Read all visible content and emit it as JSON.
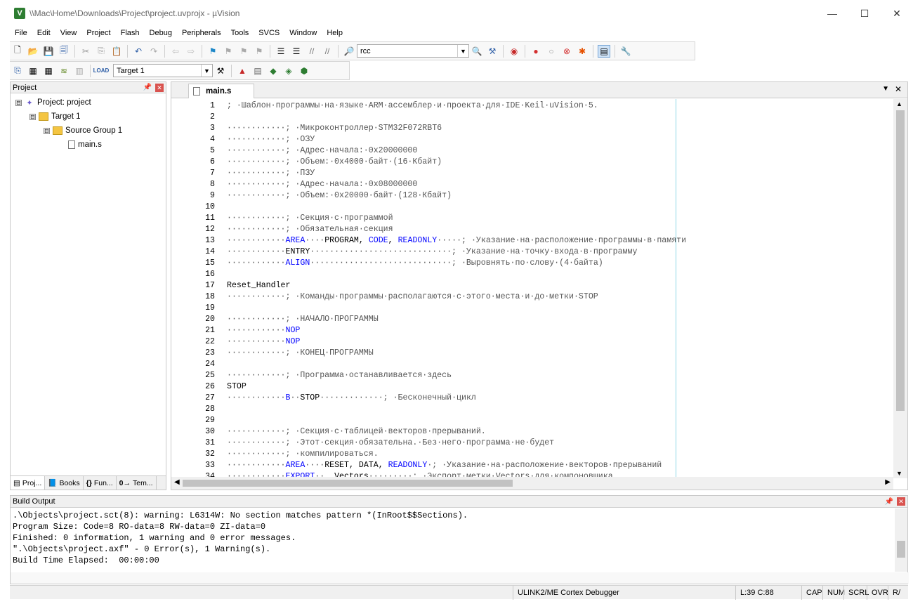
{
  "window": {
    "title": "\\\\Mac\\Home\\Downloads\\Project\\project.uvprojx - µVision",
    "logo": "V",
    "controls": {
      "minimize": "—",
      "maximize": "☐",
      "close": "✕"
    }
  },
  "menu": [
    "File",
    "Edit",
    "View",
    "Project",
    "Flash",
    "Debug",
    "Peripherals",
    "Tools",
    "SVCS",
    "Window",
    "Help"
  ],
  "toolbar": {
    "find_value": "rcc",
    "target_value": "Target 1"
  },
  "project_panel": {
    "title": "Project",
    "tree": [
      {
        "label": "Project: project",
        "expander": "⊟"
      },
      {
        "label": "Target 1",
        "expander": "⊟"
      },
      {
        "label": "Source Group 1",
        "expander": "⊟"
      },
      {
        "label": "main.s"
      }
    ],
    "tabs": [
      "Proj...",
      "Books",
      "Fun...",
      "Tem..."
    ]
  },
  "editor": {
    "tab_label": "main.s",
    "lines": [
      {
        "n": "1",
        "segs": [
          {
            "t": "; ·Шаблон·программы·на·языке·ARM·ассемблер·и·проекта·для·IDE·Keil·uVision·5.",
            "c": "g"
          }
        ]
      },
      {
        "n": "2",
        "segs": []
      },
      {
        "n": "3",
        "segs": [
          {
            "t": "············; ·Микроконтроллер·STM32F072RBT6",
            "c": "g"
          }
        ]
      },
      {
        "n": "4",
        "segs": [
          {
            "t": "············; ·ОЗУ",
            "c": "g"
          }
        ]
      },
      {
        "n": "5",
        "segs": [
          {
            "t": "············; ·Адрес·начала:·0x20000000",
            "c": "g"
          }
        ]
      },
      {
        "n": "6",
        "segs": [
          {
            "t": "············; ·Объем:·0x4000·байт·(16·Кбайт)",
            "c": "g"
          }
        ]
      },
      {
        "n": "7",
        "segs": [
          {
            "t": "············; ·ПЗУ",
            "c": "g"
          }
        ]
      },
      {
        "n": "8",
        "segs": [
          {
            "t": "············; ·Адрес·начала:·0x08000000",
            "c": "g"
          }
        ]
      },
      {
        "n": "9",
        "segs": [
          {
            "t": "············; ·Объем:·0x20000·байт·(128·Кбайт)",
            "c": "g"
          }
        ]
      },
      {
        "n": "10",
        "segs": []
      },
      {
        "n": "11",
        "segs": [
          {
            "t": "············; ·Секция·с·программой",
            "c": "g"
          }
        ]
      },
      {
        "n": "12",
        "segs": [
          {
            "t": "············; ·Обязательная·секция",
            "c": "g"
          }
        ]
      },
      {
        "n": "13",
        "segs": [
          {
            "t": "············",
            "c": "g"
          },
          {
            "t": "AREA",
            "c": "k"
          },
          {
            "t": "····",
            "c": "g"
          },
          {
            "t": "PROGRAM, ",
            "c": "d"
          },
          {
            "t": "CODE",
            "c": "k"
          },
          {
            "t": ", ",
            "c": "d"
          },
          {
            "t": "READONLY",
            "c": "k"
          },
          {
            "t": "·····; ·Указание·на·расположение·программы·в·памяти",
            "c": "g"
          }
        ]
      },
      {
        "n": "14",
        "segs": [
          {
            "t": "············",
            "c": "g"
          },
          {
            "t": "ENTRY",
            "c": "d"
          },
          {
            "t": "·····························; ·Указание·на·точку·входа·в·программу",
            "c": "g"
          }
        ]
      },
      {
        "n": "15",
        "segs": [
          {
            "t": "············",
            "c": "g"
          },
          {
            "t": "ALIGN",
            "c": "k"
          },
          {
            "t": "·····························; ·Выровнять·по·слову·(4·байта)",
            "c": "g"
          }
        ]
      },
      {
        "n": "16",
        "segs": []
      },
      {
        "n": "17",
        "segs": [
          {
            "t": "Reset_Handler",
            "c": "d"
          }
        ]
      },
      {
        "n": "18",
        "segs": [
          {
            "t": "············; ·Команды·программы·располагаются·с·этого·места·и·до·метки·STOP",
            "c": "g"
          }
        ]
      },
      {
        "n": "19",
        "segs": []
      },
      {
        "n": "20",
        "segs": [
          {
            "t": "············; ·НАЧАЛО·ПРОГРАММЫ",
            "c": "g"
          }
        ]
      },
      {
        "n": "21",
        "segs": [
          {
            "t": "············",
            "c": "g"
          },
          {
            "t": "NOP",
            "c": "k"
          }
        ]
      },
      {
        "n": "22",
        "segs": [
          {
            "t": "············",
            "c": "g"
          },
          {
            "t": "NOP",
            "c": "k"
          }
        ]
      },
      {
        "n": "23",
        "segs": [
          {
            "t": "············; ·КОНЕЦ·ПРОГРАММЫ",
            "c": "g"
          }
        ]
      },
      {
        "n": "24",
        "segs": []
      },
      {
        "n": "25",
        "segs": [
          {
            "t": "············; ·Программа·останавливается·здесь",
            "c": "g"
          }
        ]
      },
      {
        "n": "26",
        "segs": [
          {
            "t": "STOP",
            "c": "d"
          }
        ]
      },
      {
        "n": "27",
        "segs": [
          {
            "t": "············",
            "c": "g"
          },
          {
            "t": "B",
            "c": "k"
          },
          {
            "t": "··",
            "c": "g"
          },
          {
            "t": "STOP",
            "c": "d"
          },
          {
            "t": "·············; ·Бесконечный·цикл",
            "c": "g"
          }
        ]
      },
      {
        "n": "28",
        "segs": []
      },
      {
        "n": "29",
        "segs": []
      },
      {
        "n": "30",
        "segs": [
          {
            "t": "············; ·Секция·с·таблицей·векторов·прерываний.",
            "c": "g"
          }
        ]
      },
      {
        "n": "31",
        "segs": [
          {
            "t": "············; ·Этот·секция·обязательна.·Без·него·программа·не·будет",
            "c": "g"
          }
        ]
      },
      {
        "n": "32",
        "segs": [
          {
            "t": "············; ·компилироваться.",
            "c": "g"
          }
        ]
      },
      {
        "n": "33",
        "segs": [
          {
            "t": "············",
            "c": "g"
          },
          {
            "t": "AREA",
            "c": "k"
          },
          {
            "t": "····",
            "c": "g"
          },
          {
            "t": "RESET, DATA, ",
            "c": "d"
          },
          {
            "t": "READONLY",
            "c": "k"
          },
          {
            "t": "·; ·Указание·на·расположение·векторов·прерываний",
            "c": "g"
          }
        ]
      },
      {
        "n": "34",
        "segs": [
          {
            "t": "············",
            "c": "g"
          },
          {
            "t": "EXPORT",
            "c": "k"
          },
          {
            "t": "··",
            "c": "g"
          },
          {
            "t": "__Vectors",
            "c": "d"
          },
          {
            "t": "·········; ·Экспорт·метки·Vectors·для·компоновщика",
            "c": "g"
          }
        ]
      }
    ]
  },
  "build_output": {
    "title": "Build Output",
    "lines": [
      ".\\Objects\\project.sct(8): warning: L6314W: No section matches pattern *(InRoot$$Sections).",
      "Program Size: Code=8 RO-data=8 RW-data=0 ZI-data=0",
      "Finished: 0 information, 1 warning and 0 error messages.",
      "\".\\Objects\\project.axf\" - 0 Error(s), 1 Warning(s).",
      "Build Time Elapsed:  00:00:00"
    ]
  },
  "status": {
    "debugger": "ULINK2/ME Cortex Debugger",
    "position": "L:39 C:88",
    "flags": [
      "CAP",
      "NUM",
      "SCRL",
      "OVR",
      "R/"
    ]
  }
}
